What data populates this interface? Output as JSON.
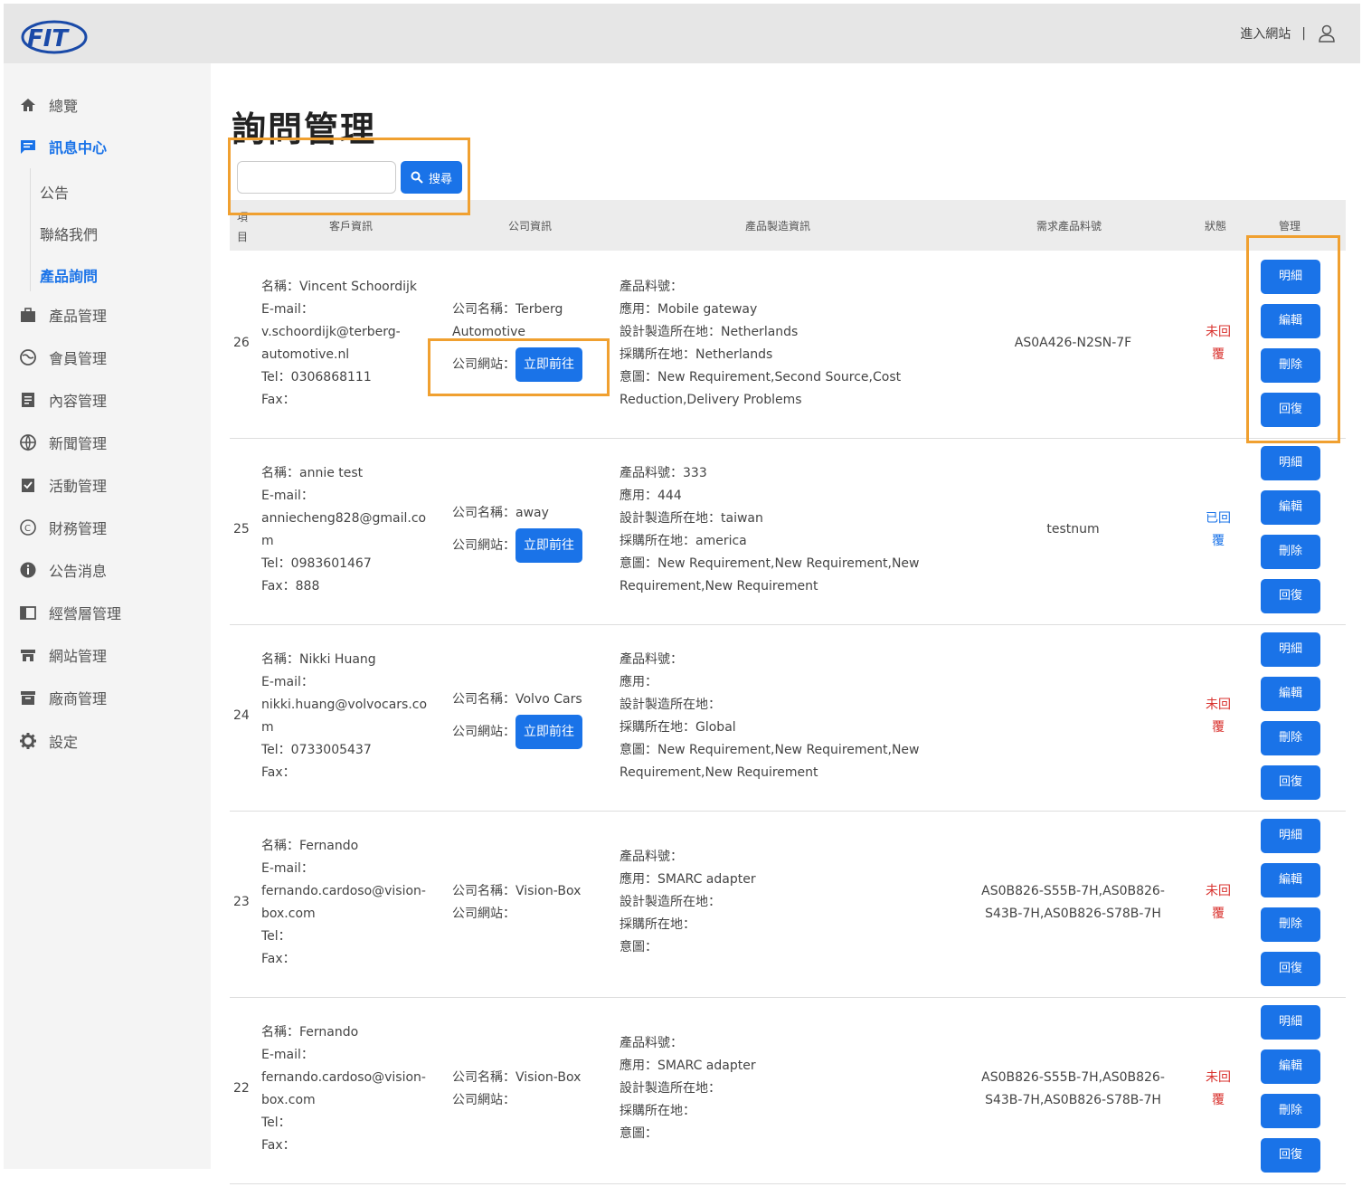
{
  "header": {
    "site_link": "進入網站",
    "separator": "|",
    "logo_alt": "FIT"
  },
  "sidebar": {
    "items": [
      {
        "label": "總覽",
        "icon": "home-icon"
      },
      {
        "label": "訊息中心",
        "icon": "message-icon",
        "active": true
      },
      {
        "label": "產品管理",
        "icon": "briefcase-icon"
      },
      {
        "label": "會員管理",
        "icon": "globe-icon"
      },
      {
        "label": "內容管理",
        "icon": "document-icon"
      },
      {
        "label": "新聞管理",
        "icon": "globe-icon"
      },
      {
        "label": "活動管理",
        "icon": "clipboard-icon"
      },
      {
        "label": "財務管理",
        "icon": "copyright-icon"
      },
      {
        "label": "公告消息",
        "icon": "info-icon"
      },
      {
        "label": "經營層管理",
        "icon": "panel-icon"
      },
      {
        "label": "網站管理",
        "icon": "store-icon"
      },
      {
        "label": "廠商管理",
        "icon": "archive-icon"
      },
      {
        "label": "設定",
        "icon": "gear-icon"
      }
    ],
    "sub_items": [
      {
        "label": "公告"
      },
      {
        "label": "聯絡我們"
      },
      {
        "label": "產品詢問",
        "active": true
      }
    ]
  },
  "page": {
    "title": "詢問管理"
  },
  "search": {
    "placeholder": "",
    "button_label": "搜尋"
  },
  "table": {
    "headers": {
      "idx": "項目",
      "customer": "客戶資訊",
      "company": "公司資訊",
      "product": "產品製造資訊",
      "part": "需求產品料號",
      "status": "狀態",
      "manage": "管理"
    },
    "go_label": "立即前往",
    "actions": [
      "明細",
      "編輯",
      "刪除",
      "回復"
    ],
    "rows": [
      {
        "id": "26",
        "customer": [
          "名稱：Vincent Schoordijk",
          "E-mail：",
          "v.schoordijk@terberg-",
          "automotive.nl",
          "Tel：0306868111",
          "Fax："
        ],
        "company_name": "公司名稱：Terberg",
        "company_name2": "Automotive",
        "company_site": "公司網站：",
        "has_link": true,
        "product": [
          "產品料號：",
          "應用：Mobile gateway",
          "設計製造所在地：Netherlands",
          "採購所在地：Netherlands",
          "意圖：New Requirement,Second Source,Cost",
          "Reduction,Delivery Problems"
        ],
        "part": [
          "AS0A426-N2SN-7F"
        ],
        "status": [
          "未回",
          "覆"
        ],
        "replied": false
      },
      {
        "id": "25",
        "customer": [
          "名稱：annie test",
          "E-mail：",
          "anniecheng828@gmail.co",
          "m",
          "Tel：0983601467",
          "Fax：888"
        ],
        "company_name": "公司名稱：away",
        "company_name2": "",
        "company_site": "公司網站：",
        "has_link": true,
        "product": [
          "產品料號：333",
          "應用：444",
          "設計製造所在地：taiwan",
          "採購所在地：america",
          "意圖：New Requirement,New Requirement,New",
          "Requirement,New Requirement"
        ],
        "part": [
          "testnum"
        ],
        "status": [
          "已回",
          "覆"
        ],
        "replied": true
      },
      {
        "id": "24",
        "customer": [
          "名稱：Nikki Huang",
          "E-mail：",
          "nikki.huang@volvocars.co",
          "m",
          "Tel：0733005437",
          "Fax："
        ],
        "company_name": "公司名稱：Volvo Cars",
        "company_name2": "",
        "company_site": "公司網站：",
        "has_link": true,
        "product": [
          "產品料號：",
          "應用：",
          "設計製造所在地：",
          "採購所在地：Global",
          "意圖：New Requirement,New Requirement,New",
          "Requirement,New Requirement"
        ],
        "part": [
          ""
        ],
        "status": [
          "未回",
          "覆"
        ],
        "replied": false
      },
      {
        "id": "23",
        "customer": [
          "名稱：Fernando",
          "E-mail：",
          "fernando.cardoso@vision-",
          "box.com",
          "Tel：",
          "Fax："
        ],
        "company_name": "公司名稱：Vision-Box",
        "company_name2": "",
        "company_site": "公司網站：",
        "has_link": false,
        "product": [
          "產品料號：",
          "應用：SMARC adapter",
          "設計製造所在地：",
          "採購所在地：",
          "意圖："
        ],
        "part": [
          "AS0B826-S55B-7H,AS0B826-",
          "S43B-7H,AS0B826-S78B-7H"
        ],
        "status": [
          "未回",
          "覆"
        ],
        "replied": false
      },
      {
        "id": "22",
        "customer": [
          "名稱：Fernando",
          "E-mail：",
          "fernando.cardoso@vision-",
          "box.com",
          "Tel：",
          "Fax："
        ],
        "company_name": "公司名稱：Vision-Box",
        "company_name2": "",
        "company_site": "公司網站：",
        "has_link": false,
        "product": [
          "產品料號：",
          "應用：SMARC adapter",
          "設計製造所在地：",
          "採購所在地：",
          "意圖："
        ],
        "part": [
          "AS0B826-S55B-7H,AS0B826-",
          "S43B-7H,AS0B826-S78B-7H"
        ],
        "status": [
          "未回",
          "覆"
        ],
        "replied": false
      }
    ]
  }
}
